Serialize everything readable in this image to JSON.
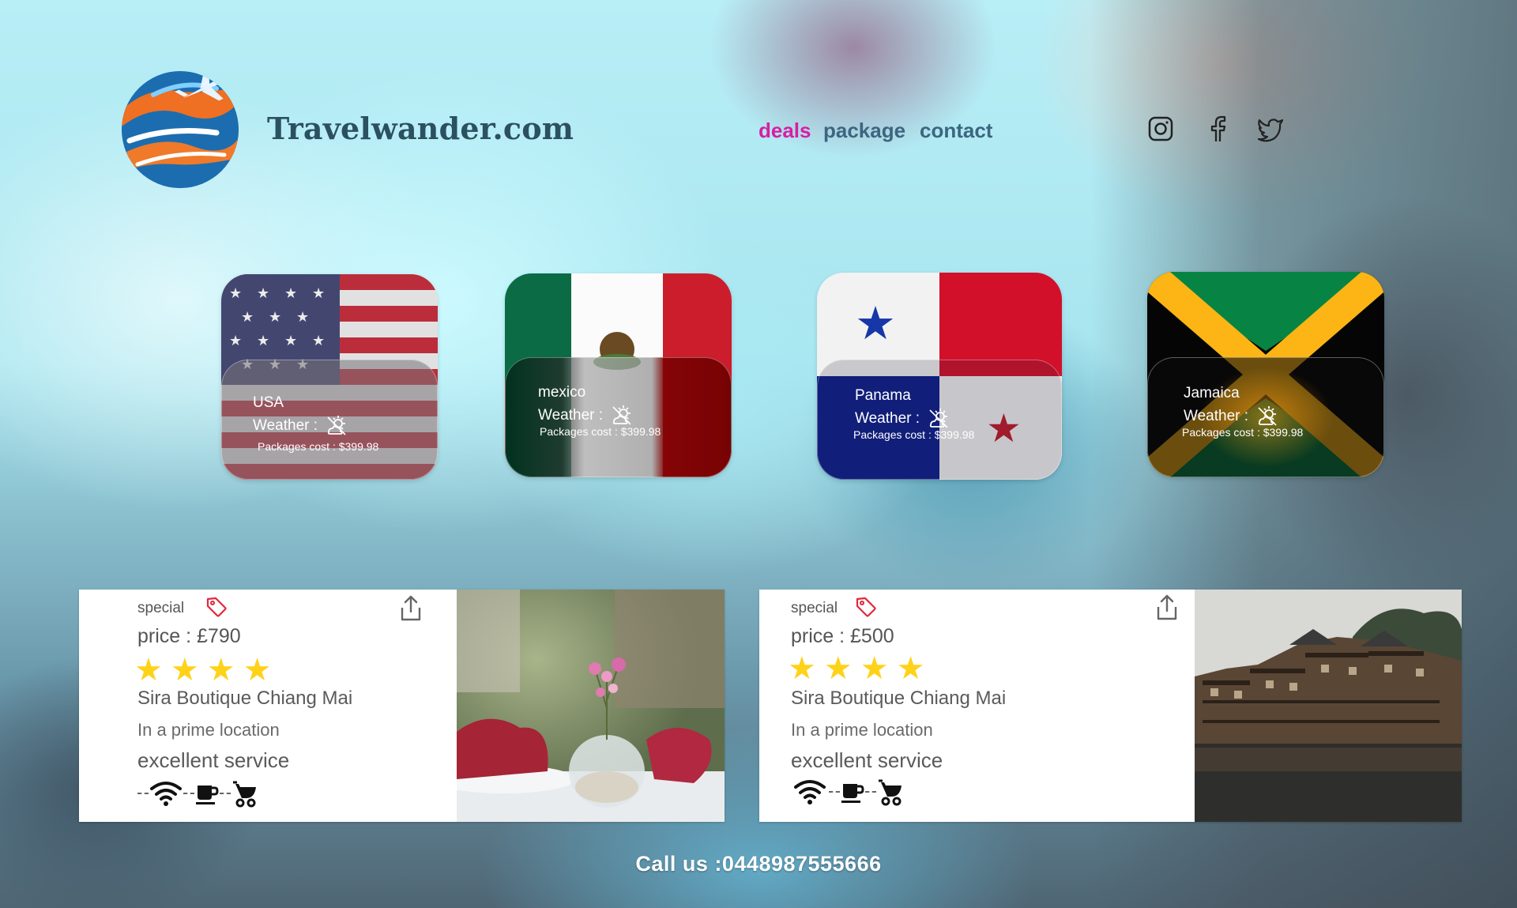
{
  "header": {
    "brand": "Travelwander.com",
    "nav": [
      {
        "label": "deals",
        "color": "#d91ea4"
      },
      {
        "label": "package",
        "color": "#3c6680"
      },
      {
        "label": "contact",
        "color": "#3c6680"
      }
    ],
    "social_icons": [
      "instagram-icon",
      "facebook-icon",
      "twitter-icon"
    ]
  },
  "destinations": [
    {
      "name": "USA",
      "weather_label": "Weather :",
      "cost": "Packages cost : $399.98",
      "weather_icon": "partly-sunny-icon"
    },
    {
      "name": "mexico",
      "weather_label": "Weather :",
      "cost": "Packages cost : $399.98",
      "weather_icon": "partly-sunny-icon"
    },
    {
      "name": "Panama",
      "weather_label": "Weather :",
      "cost": "Packages cost : $399.98",
      "weather_icon": "partly-sunny-icon"
    },
    {
      "name": "Jamaica",
      "weather_label": "Weather :",
      "cost": "Packages cost : $399.98",
      "weather_icon": "partly-sunny-icon"
    }
  ],
  "hotels": [
    {
      "special": "special",
      "price": "price : £790",
      "stars": 4,
      "name": "Sira Boutique Chiang Mai",
      "location": "In a prime location",
      "service": "excellent service",
      "amenities": [
        "wifi-icon",
        "coffee-icon",
        "stroller-icon"
      ]
    },
    {
      "special": "special",
      "price": "price : £500",
      "stars": 4,
      "name": "Sira Boutique Chiang Mai",
      "location": "In a prime location",
      "service": "excellent service",
      "amenities": [
        "wifi-icon",
        "coffee-icon",
        "stroller-icon"
      ]
    }
  ],
  "footer": {
    "call": "Call us :0448987555666"
  },
  "colors": {
    "accent": "#d91ea4",
    "nav": "#3c6680",
    "brand": "#2b5060",
    "star": "#ffd21a",
    "tag": "#e0283c"
  }
}
